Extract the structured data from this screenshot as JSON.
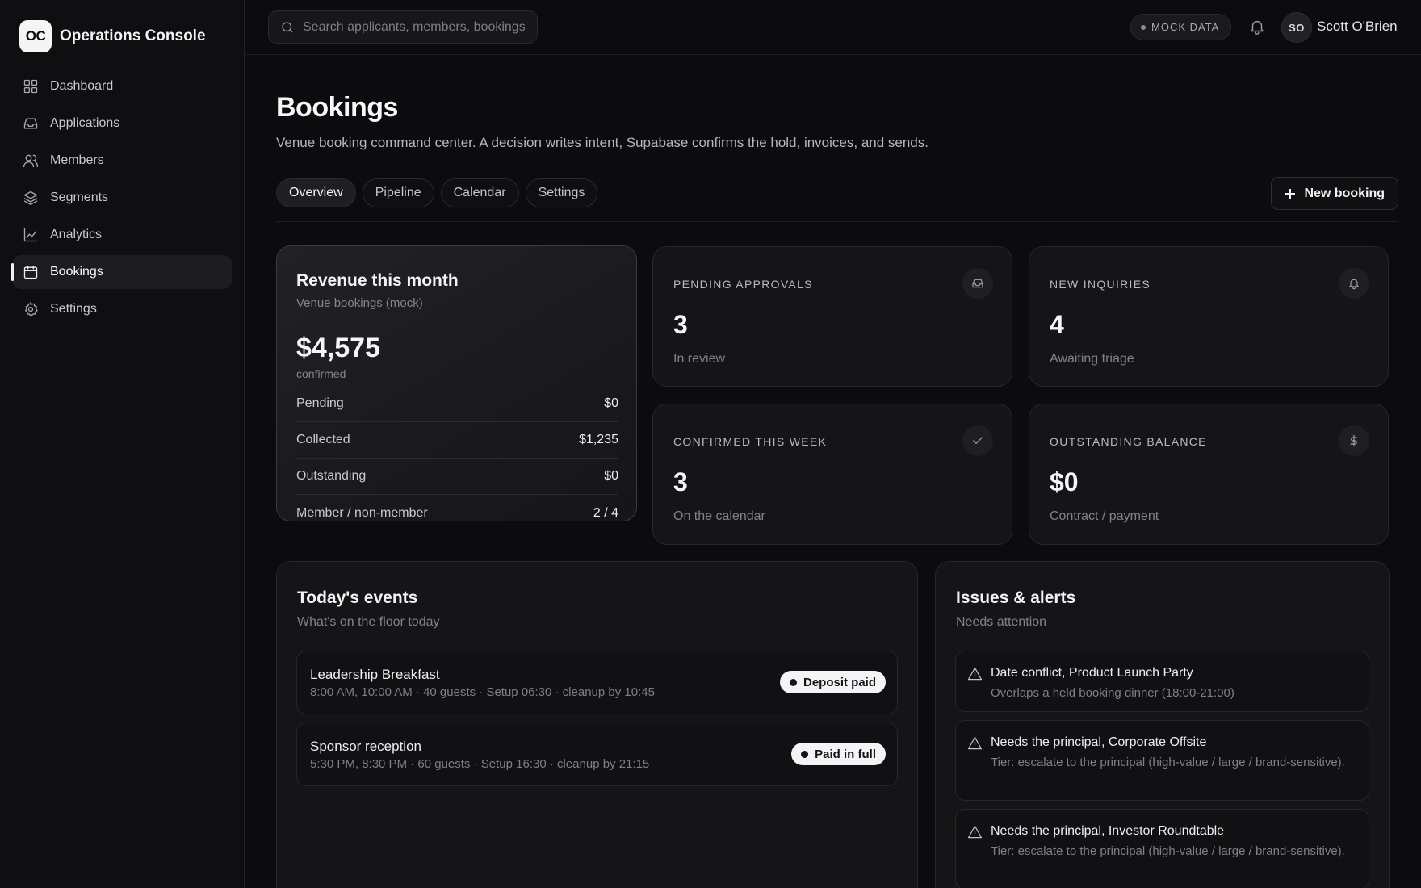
{
  "brand": {
    "logo": "OC",
    "name": "Operations Console"
  },
  "nav": [
    {
      "label": "Dashboard",
      "icon": "grid-icon",
      "active": false
    },
    {
      "label": "Applications",
      "icon": "inbox-icon",
      "active": false
    },
    {
      "label": "Members",
      "icon": "users-icon",
      "active": false
    },
    {
      "label": "Segments",
      "icon": "layers-icon",
      "active": false
    },
    {
      "label": "Analytics",
      "icon": "chart-line-icon",
      "active": false
    },
    {
      "label": "Bookings",
      "icon": "calendar-icon",
      "active": true
    },
    {
      "label": "Settings",
      "icon": "gear-icon",
      "active": false
    }
  ],
  "topbar": {
    "search_placeholder": "Search applicants, members, bookings",
    "mock_badge": "MOCK DATA",
    "user_initials": "SO",
    "user_name": "Scott O'Brien"
  },
  "page": {
    "title": "Bookings",
    "subtitle": "Venue booking command center. A decision writes intent, Supabase confirms the hold, invoices, and sends.",
    "tabs": [
      {
        "label": "Overview",
        "active": true
      },
      {
        "label": "Pipeline",
        "active": false
      },
      {
        "label": "Calendar",
        "active": false
      },
      {
        "label": "Settings",
        "active": false
      }
    ],
    "new_booking_label": "New booking"
  },
  "revenue": {
    "title": "Revenue this month",
    "subtitle": "Venue bookings (mock)",
    "amount": "$4,575",
    "amount_caption": "confirmed",
    "rows": [
      {
        "label": "Pending",
        "value": "$0"
      },
      {
        "label": "Collected",
        "value": "$1,235"
      },
      {
        "label": "Outstanding",
        "value": "$0"
      },
      {
        "label": "Member / non-member",
        "value": "2 / 4"
      }
    ]
  },
  "stats": [
    {
      "label": "PENDING APPROVALS",
      "value": "3",
      "sub": "In review",
      "icon": "inbox-icon"
    },
    {
      "label": "NEW INQUIRIES",
      "value": "4",
      "sub": "Awaiting triage",
      "icon": "bell-icon"
    },
    {
      "label": "CONFIRMED THIS WEEK",
      "value": "3",
      "sub": "On the calendar",
      "icon": "check-icon"
    },
    {
      "label": "OUTSTANDING BALANCE",
      "value": "$0",
      "sub": "Contract / payment",
      "icon": "dollar-icon"
    }
  ],
  "events": {
    "title": "Today's events",
    "subtitle": "What's on the floor today",
    "items": [
      {
        "name": "Leadership Breakfast",
        "meta": "8:00 AM, 10:00 AM · 40 guests · Setup 06:30 · cleanup by 10:45",
        "badge": "Deposit paid"
      },
      {
        "name": "Sponsor reception",
        "meta": "5:30 PM, 8:30 PM · 60 guests · Setup 16:30 · cleanup by 21:15",
        "badge": "Paid in full"
      }
    ]
  },
  "alerts": {
    "title": "Issues & alerts",
    "subtitle": "Needs attention",
    "items": [
      {
        "title": "Date conflict, Product Launch Party",
        "desc": "Overlaps a held booking dinner (18:00-21:00)",
        "icon": "warning-icon"
      },
      {
        "title": "Needs the principal, Corporate Offsite",
        "desc": "Tier: escalate to the principal (high-value / large / brand-sensitive).",
        "icon": "warning-icon"
      },
      {
        "title": "Needs the principal, Investor Roundtable",
        "desc": "Tier: escalate to the principal (high-value / large / brand-sensitive).",
        "icon": "warning-icon"
      }
    ]
  },
  "colors": {
    "background": "#0c0c0e",
    "card": "#151518",
    "accent": "#f4f4f6",
    "muted": "#82828a"
  }
}
